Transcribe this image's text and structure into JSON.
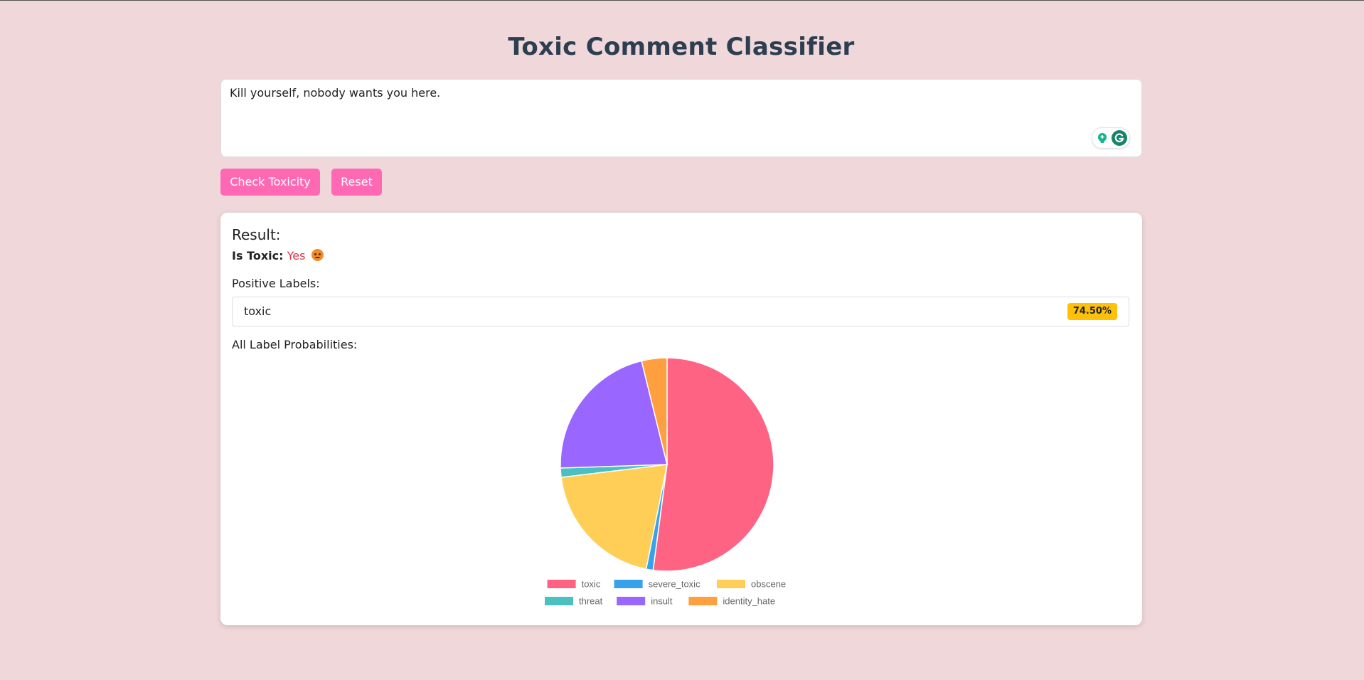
{
  "title": "Toxic Comment Classifier",
  "comment": {
    "text": "Kill yourself, nobody wants you here."
  },
  "buttons": {
    "check": "Check Toxicity",
    "reset": "Reset"
  },
  "result": {
    "heading": "Result:",
    "is_toxic_label": "Is Toxic:",
    "is_toxic_value": "Yes",
    "is_toxic_icon": "angry-face-icon",
    "positive_heading": "Positive Labels:",
    "positive_labels": [
      {
        "label": "toxic",
        "score": "74.50%"
      }
    ],
    "all_heading": "All Label Probabilities:"
  },
  "colors": {
    "background": "#f0d8da",
    "title": "#2c3e50",
    "button": "#ff69b4",
    "toxic_yes": "#dc3545",
    "badge": "#ffc107"
  },
  "chart_data": {
    "type": "pie",
    "categories": [
      "toxic",
      "severe_toxic",
      "obscene",
      "threat",
      "insult",
      "identity_hate"
    ],
    "values": [
      0.745,
      0.015,
      0.285,
      0.02,
      0.31,
      0.055
    ],
    "colors": [
      "#ff6384",
      "#36a2eb",
      "#ffce56",
      "#4bc0c0",
      "#9966ff",
      "#ff9f40"
    ],
    "start_angle_deg": -90,
    "legend": "bottom",
    "title": ""
  }
}
